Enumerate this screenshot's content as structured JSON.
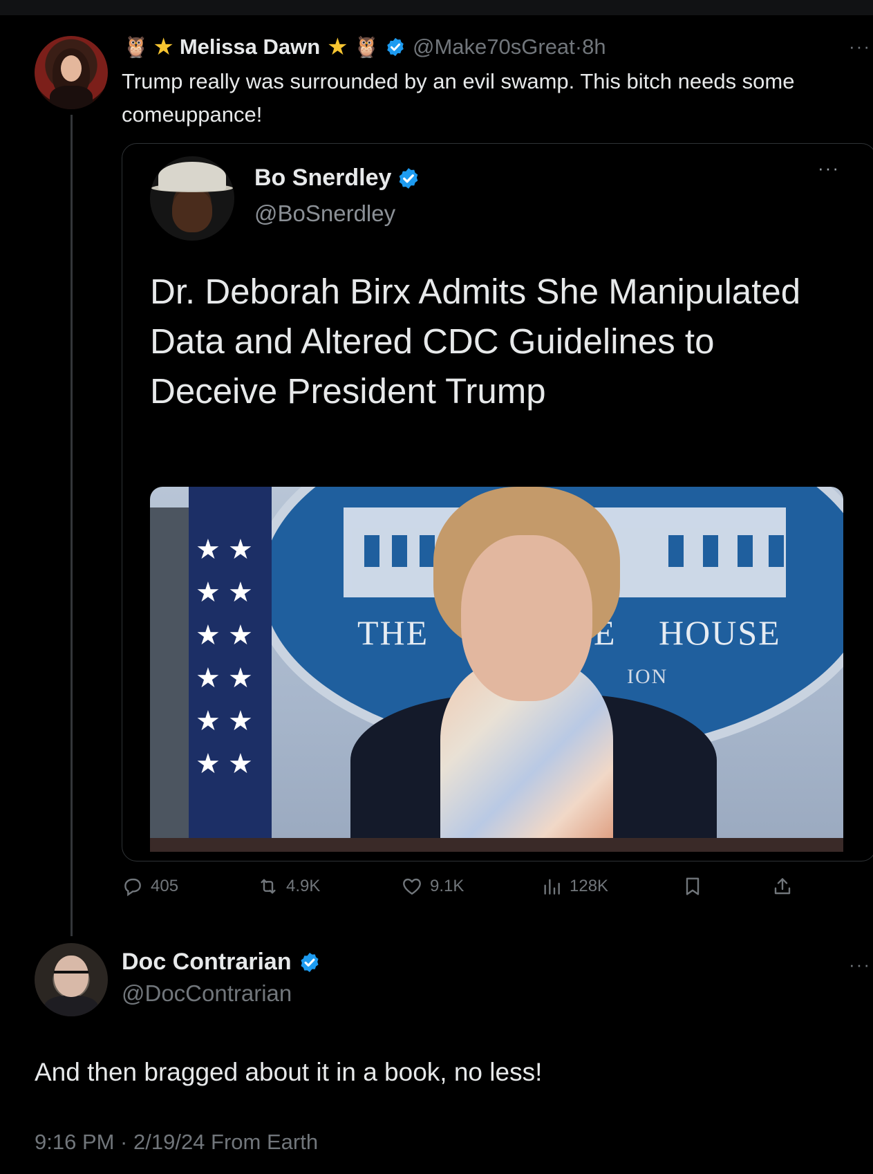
{
  "tweet": {
    "emoji_left": "🦉",
    "display_name": "Melissa Dawn",
    "emoji_right": "🦉",
    "handle": "@Make70sGreat",
    "separator": "·",
    "time": "8h",
    "more": "···",
    "text": "Trump really was surrounded by an evil swamp. This bitch needs some comeuppance!",
    "colors": {
      "verified": "#1d9bf0",
      "star": "#f7c531"
    }
  },
  "quote": {
    "display_name": "Bo Snerdley",
    "handle": "@BoSnerdley",
    "more": "···",
    "headline": "Dr. Deborah Birx Admits She Manipulated Data and Altered CDC Guidelines to Deceive President Trump",
    "photo": {
      "seal_text_left": "THE",
      "seal_text_mid": "E",
      "seal_text_right": "HOUSE",
      "seal_text_sub": "ION"
    }
  },
  "actions": {
    "replies": "405",
    "reposts": "4.9K",
    "likes": "9.1K",
    "views": "128K"
  },
  "reply": {
    "display_name": "Doc Contrarian",
    "handle": "@DocContrarian",
    "more": "···",
    "text": "And then bragged about it in a book, no less!",
    "meta": "9:16 PM · 2/19/24 From Earth"
  }
}
